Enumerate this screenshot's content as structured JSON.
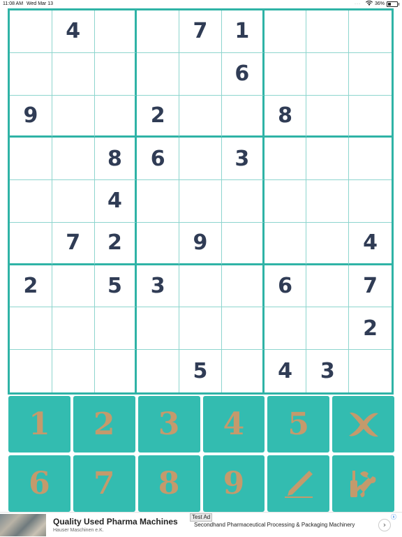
{
  "status_bar": {
    "time": "11:08 AM",
    "date": "Wed Mar 13",
    "battery": "36%",
    "dots": "···"
  },
  "board": {
    "cells": [
      [
        "",
        "4",
        "",
        "",
        "7",
        "1",
        "",
        "",
        ""
      ],
      [
        "",
        "",
        "",
        "",
        "",
        "6",
        "",
        "",
        ""
      ],
      [
        "9",
        "",
        "",
        "2",
        "",
        "",
        "8",
        "",
        ""
      ],
      [
        "",
        "",
        "8",
        "6",
        "",
        "3",
        "",
        "",
        ""
      ],
      [
        "",
        "",
        "4",
        "",
        "",
        "",
        "",
        "",
        ""
      ],
      [
        "",
        "7",
        "2",
        "",
        "9",
        "",
        "",
        "",
        "4"
      ],
      [
        "2",
        "",
        "5",
        "3",
        "",
        "",
        "6",
        "",
        "7"
      ],
      [
        "",
        "",
        "",
        "",
        "",
        "",
        "",
        "",
        "2"
      ],
      [
        "",
        "",
        "",
        "",
        "5",
        "",
        "4",
        "3",
        ""
      ]
    ]
  },
  "colors": {
    "grid_line": "#2fb3a6",
    "thin_line": "#8dd5ce",
    "digit": "#303c55",
    "key_bg": "#33bcb0",
    "key_fg": "#c49a6c"
  },
  "keypad": {
    "keys": [
      {
        "label": "1",
        "icon": ""
      },
      {
        "label": "2",
        "icon": ""
      },
      {
        "label": "3",
        "icon": ""
      },
      {
        "label": "4",
        "icon": ""
      },
      {
        "label": "5",
        "icon": ""
      },
      {
        "label": "",
        "icon": "x-icon"
      },
      {
        "label": "6",
        "icon": ""
      },
      {
        "label": "7",
        "icon": ""
      },
      {
        "label": "8",
        "icon": ""
      },
      {
        "label": "9",
        "icon": ""
      },
      {
        "label": "",
        "icon": "pencil-icon"
      },
      {
        "label": "",
        "icon": "tools-icon"
      }
    ]
  },
  "ad": {
    "title": "Quality Used Pharma Machines",
    "advertiser": "Hauser Maschinen e.K.",
    "badge": "Test Ad",
    "description": "Secondhand Pharmaceutical Processing & Packaging Machinery",
    "arrow": "›",
    "close": "ⓧ"
  }
}
